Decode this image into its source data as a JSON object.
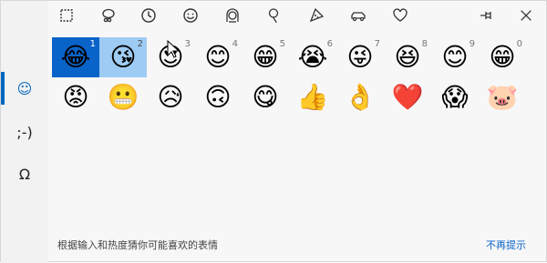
{
  "rail": {
    "items": [
      {
        "label": "☺",
        "name": "emoji-tab",
        "active": true
      },
      {
        "label": ";-)",
        "name": "kaomoji-tab",
        "active": false
      },
      {
        "label": "Ω",
        "name": "symbols-tab",
        "active": false
      }
    ]
  },
  "topbar": {
    "categories": [
      {
        "name": "recent-icon"
      },
      {
        "name": "people-icon"
      },
      {
        "name": "clock-icon"
      },
      {
        "name": "smiley-face-icon"
      },
      {
        "name": "person-face-icon"
      },
      {
        "name": "balloon-icon"
      },
      {
        "name": "pizza-icon"
      },
      {
        "name": "car-icon"
      },
      {
        "name": "heart-icon"
      }
    ]
  },
  "grid": {
    "row1": [
      {
        "emoji": "😂",
        "num": "1"
      },
      {
        "emoji": "😘",
        "num": "2"
      },
      {
        "emoji": "😍",
        "num": "3"
      },
      {
        "emoji": "😊",
        "num": "4"
      },
      {
        "emoji": "😁",
        "num": "5"
      },
      {
        "emoji": "😭",
        "num": "6"
      },
      {
        "emoji": "😜",
        "num": "7"
      },
      {
        "emoji": "😆",
        "num": "8"
      },
      {
        "emoji": "😊",
        "num": "9"
      },
      {
        "emoji": "😁",
        "num": "0"
      }
    ],
    "row2": [
      {
        "emoji": "😡",
        "num": ""
      },
      {
        "emoji": "😬",
        "num": ""
      },
      {
        "emoji": "😥",
        "num": ""
      },
      {
        "emoji": "🙃",
        "num": ""
      },
      {
        "emoji": "😋",
        "num": ""
      },
      {
        "emoji": "👍",
        "num": ""
      },
      {
        "emoji": "👌",
        "num": ""
      },
      {
        "emoji": "❤️",
        "num": ""
      },
      {
        "emoji": "😱",
        "num": ""
      },
      {
        "emoji": "🐷",
        "num": ""
      }
    ]
  },
  "footer": {
    "hint": "根据输入和热度猜你可能喜欢的表情",
    "dismiss": "不再提示"
  },
  "colors": {
    "accent": "#0a63c9",
    "selected_light": "#9ecbf3"
  }
}
